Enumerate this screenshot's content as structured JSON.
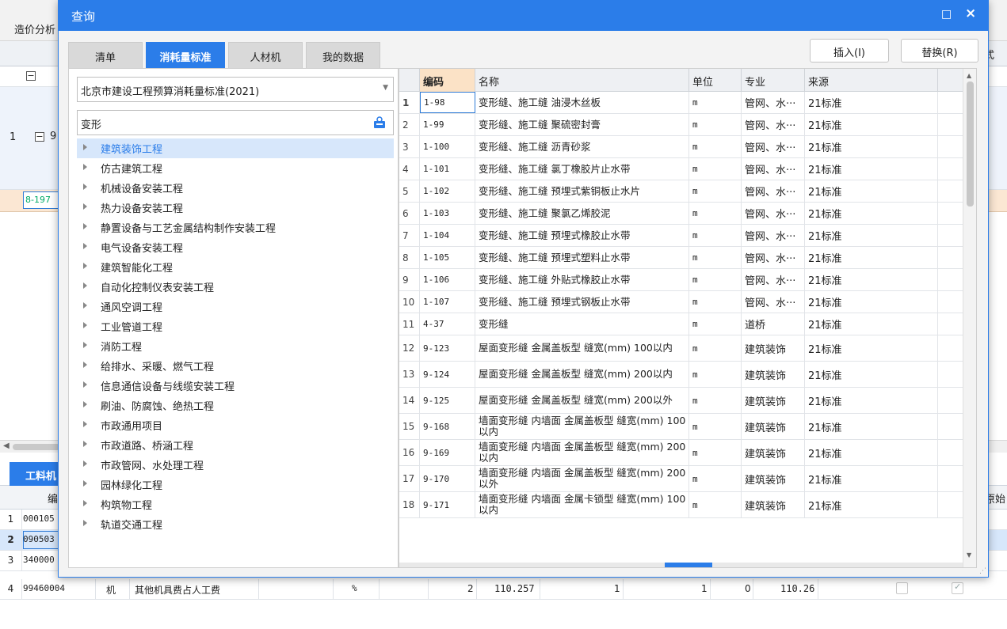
{
  "background": {
    "toolbar_tab": "造价分析",
    "row1_index": "1",
    "row1_code": "9",
    "minus": "−",
    "selected_row_code": "8-197",
    "header_right": "式",
    "lower_tab": "工料机",
    "lower_header_code": "编",
    "lower_header_right": "原始",
    "lower_rows": [
      {
        "index": "1",
        "code": "000105",
        "selected": false
      },
      {
        "index": "2",
        "code": "090503",
        "selected": true
      },
      {
        "index": "3",
        "code": "340000",
        "selected": false
      },
      {
        "index": "4",
        "code": "99460004",
        "type": "机",
        "name": "其他机具费占人工费",
        "unit": "%",
        "qty": "2",
        "price": "110.257",
        "c1": "1",
        "c2": "1",
        "c3": "0",
        "total": "110.26",
        "selected": false
      }
    ]
  },
  "dialog": {
    "title": "查询",
    "maximize": "□",
    "close": "×",
    "tabs": [
      {
        "label": "清单",
        "active": false
      },
      {
        "label": "消耗量标准",
        "active": true
      },
      {
        "label": "人材机",
        "active": false
      },
      {
        "label": "我的数据",
        "active": false
      }
    ],
    "insert_label": "插入(I)",
    "replace_label": "替换(R)",
    "standard_select": "北京市建设工程预算消耗量标准(2021)",
    "search_value": "变形",
    "tree_items": [
      {
        "label": "建筑装饰工程",
        "selected": true
      },
      {
        "label": "仿古建筑工程"
      },
      {
        "label": "机械设备安装工程"
      },
      {
        "label": "热力设备安装工程"
      },
      {
        "label": "静置设备与工艺金属结构制作安装工程"
      },
      {
        "label": "电气设备安装工程"
      },
      {
        "label": "建筑智能化工程"
      },
      {
        "label": "自动化控制仪表安装工程"
      },
      {
        "label": "通风空调工程"
      },
      {
        "label": "工业管道工程"
      },
      {
        "label": "消防工程"
      },
      {
        "label": "给排水、采暖、燃气工程"
      },
      {
        "label": "信息通信设备与线缆安装工程"
      },
      {
        "label": "刷油、防腐蚀、绝热工程"
      },
      {
        "label": "市政通用项目"
      },
      {
        "label": "市政道路、桥涵工程"
      },
      {
        "label": "市政管网、水处理工程"
      },
      {
        "label": "园林绿化工程"
      },
      {
        "label": "构筑物工程"
      },
      {
        "label": "轨道交通工程"
      }
    ],
    "columns": {
      "code": "编码",
      "name": "名称",
      "unit": "单位",
      "specialty": "专业",
      "source": "来源"
    },
    "rows": [
      {
        "index": "1",
        "code": "1-98",
        "name": "变形缝、施工缝 油浸木丝板",
        "unit": "m",
        "specialty": "管网、水···",
        "source": "21标准"
      },
      {
        "index": "2",
        "code": "1-99",
        "name": "变形缝、施工缝 聚硫密封膏",
        "unit": "m",
        "specialty": "管网、水···",
        "source": "21标准"
      },
      {
        "index": "3",
        "code": "1-100",
        "name": "变形缝、施工缝 沥青砂浆",
        "unit": "m",
        "specialty": "管网、水···",
        "source": "21标准"
      },
      {
        "index": "4",
        "code": "1-101",
        "name": "变形缝、施工缝 氯丁橡胶片止水带",
        "unit": "m",
        "specialty": "管网、水···",
        "source": "21标准"
      },
      {
        "index": "5",
        "code": "1-102",
        "name": "变形缝、施工缝 预埋式紫铜板止水片",
        "unit": "m",
        "specialty": "管网、水···",
        "source": "21标准"
      },
      {
        "index": "6",
        "code": "1-103",
        "name": "变形缝、施工缝 聚氯乙烯胶泥",
        "unit": "m",
        "specialty": "管网、水···",
        "source": "21标准"
      },
      {
        "index": "7",
        "code": "1-104",
        "name": "变形缝、施工缝 预埋式橡胶止水带",
        "unit": "m",
        "specialty": "管网、水···",
        "source": "21标准"
      },
      {
        "index": "8",
        "code": "1-105",
        "name": "变形缝、施工缝 预埋式塑料止水带",
        "unit": "m",
        "specialty": "管网、水···",
        "source": "21标准"
      },
      {
        "index": "9",
        "code": "1-106",
        "name": "变形缝、施工缝 外贴式橡胶止水带",
        "unit": "m",
        "specialty": "管网、水···",
        "source": "21标准"
      },
      {
        "index": "10",
        "code": "1-107",
        "name": "变形缝、施工缝 预埋式钢板止水带",
        "unit": "m",
        "specialty": "管网、水···",
        "source": "21标准"
      },
      {
        "index": "11",
        "code": "4-37",
        "name": "变形缝",
        "unit": "m",
        "specialty": "道桥",
        "source": "21标准"
      },
      {
        "index": "12",
        "code": "9-123",
        "name": "屋面变形缝 金属盖板型 缝宽(mm) 100以内",
        "unit": "m",
        "specialty": "建筑装饰",
        "source": "21标准"
      },
      {
        "index": "13",
        "code": "9-124",
        "name": "屋面变形缝 金属盖板型 缝宽(mm) 200以内",
        "unit": "m",
        "specialty": "建筑装饰",
        "source": "21标准"
      },
      {
        "index": "14",
        "code": "9-125",
        "name": "屋面变形缝 金属盖板型 缝宽(mm) 200以外",
        "unit": "m",
        "specialty": "建筑装饰",
        "source": "21标准"
      },
      {
        "index": "15",
        "code": "9-168",
        "name": "墙面变形缝 内墙面 金属盖板型 缝宽(mm) 100以内",
        "unit": "m",
        "specialty": "建筑装饰",
        "source": "21标准"
      },
      {
        "index": "16",
        "code": "9-169",
        "name": "墙面变形缝 内墙面 金属盖板型 缝宽(mm) 200以内",
        "unit": "m",
        "specialty": "建筑装饰",
        "source": "21标准"
      },
      {
        "index": "17",
        "code": "9-170",
        "name": "墙面变形缝 内墙面 金属盖板型 缝宽(mm) 200以外",
        "unit": "m",
        "specialty": "建筑装饰",
        "source": "21标准"
      },
      {
        "index": "18",
        "code": "9-171",
        "name": "墙面变形缝 内墙面 金属卡锁型 缝宽(mm) 100以内",
        "unit": "m",
        "specialty": "建筑装饰",
        "source": "21标准"
      }
    ]
  }
}
